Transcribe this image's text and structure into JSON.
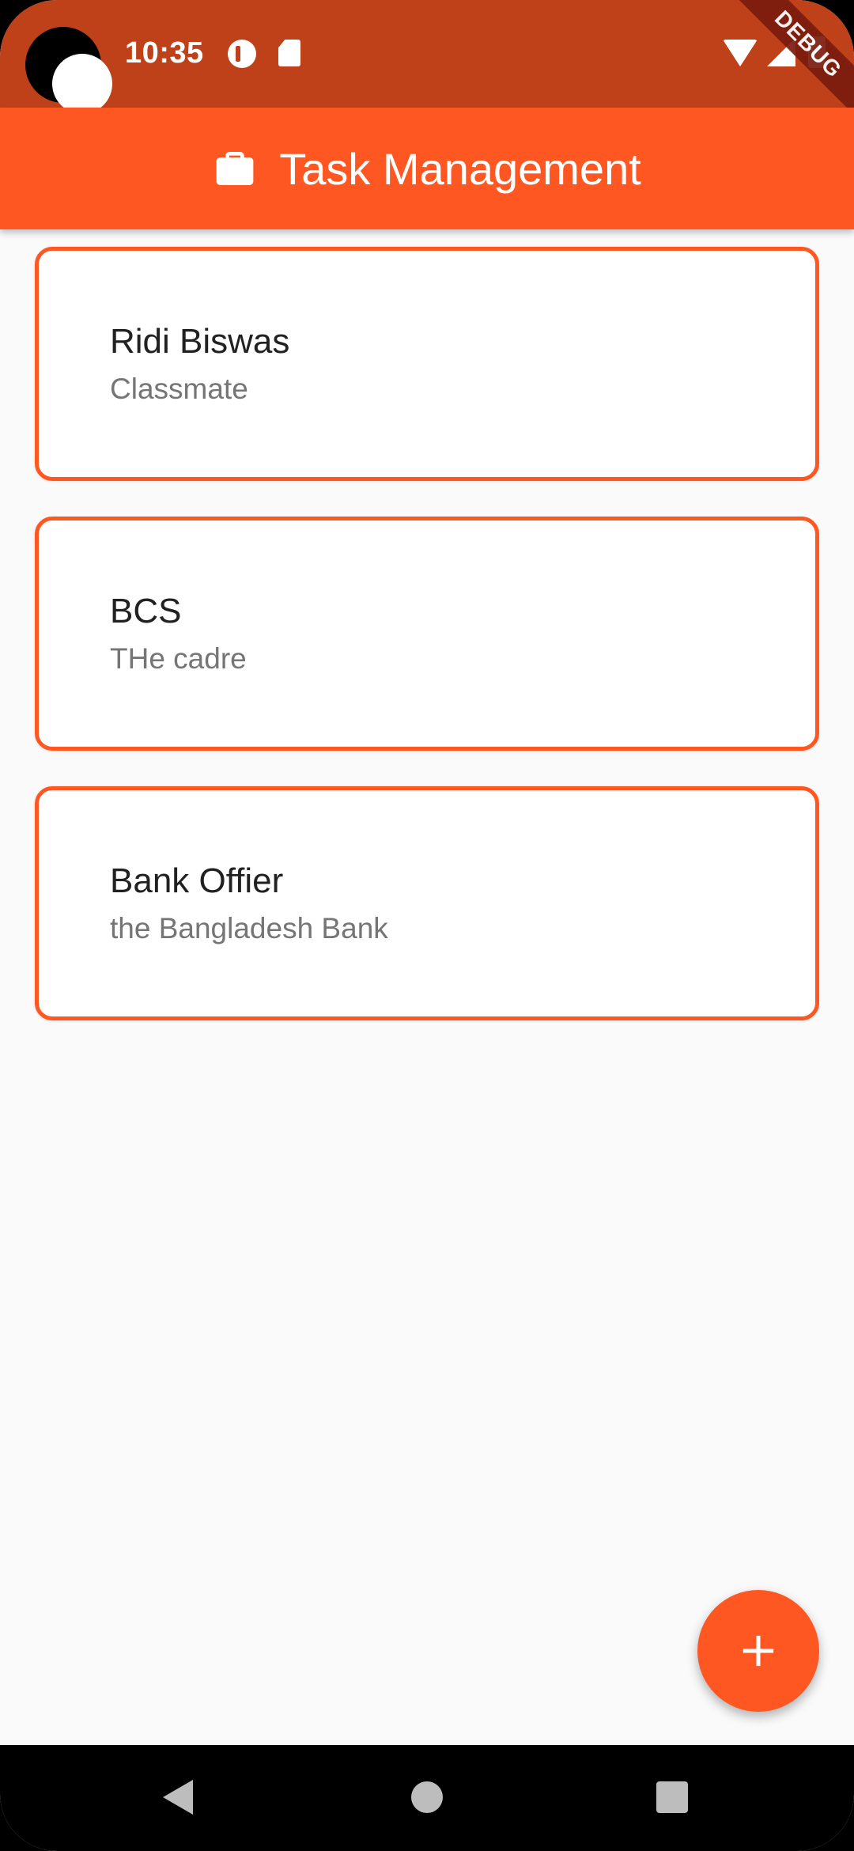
{
  "status_bar": {
    "time": "10:35",
    "debug_label": "DEBUG"
  },
  "app_bar": {
    "title": "Task Management",
    "icon": "briefcase-icon"
  },
  "tasks": [
    {
      "title": "Ridi Biswas",
      "subtitle": "Classmate"
    },
    {
      "title": "BCS",
      "subtitle": "THe cadre"
    },
    {
      "title": "Bank Offier",
      "subtitle": "the Bangladesh Bank"
    }
  ],
  "fab": {
    "icon": "plus-icon"
  },
  "colors": {
    "primary": "#ff5722",
    "status_bar": "#bf4119",
    "background": "#fafafa"
  }
}
